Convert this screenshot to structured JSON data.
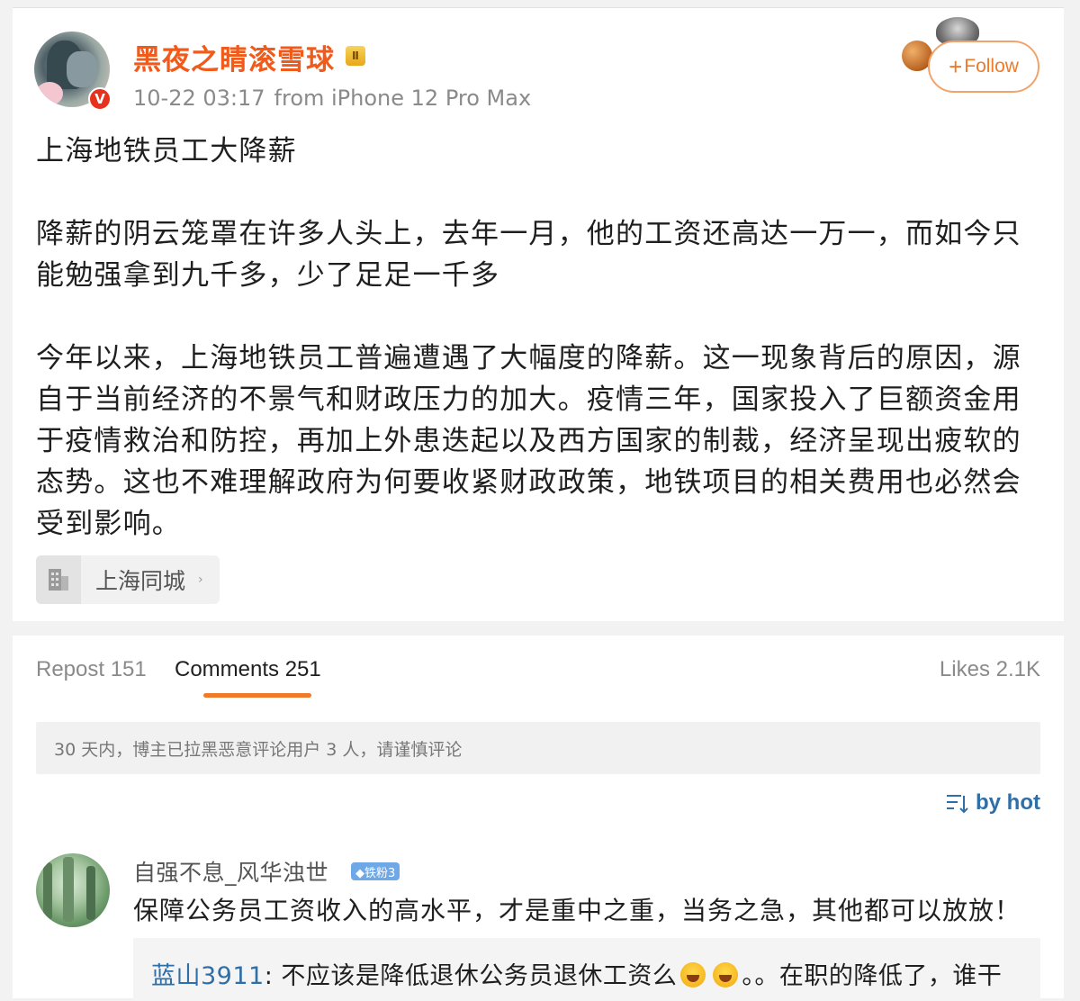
{
  "post": {
    "author": "黑夜之睛滚雪球",
    "verified_badge": "V",
    "level_badge": "Ⅱ",
    "time": "10-22 03:17",
    "source": "from iPhone 12 Pro Max",
    "follow_label": "Follow",
    "follow_plus": "+",
    "paragraphs": [
      "上海地铁员工大降薪",
      "降薪的阴云笼罩在许多人头上，去年一月，他的工资还高达一万一，而如今只能勉强拿到九千多，少了足足一千多",
      "今年以来，上海地铁员工普遍遭遇了大幅度的降薪。这一现象背后的原因，源自于当前经济的不景气和财政压力的加大。疫情三年，国家投入了巨额资金用于疫情救治和防控，再加上外患迭起以及西方国家的制裁，经济呈现出疲软的态势。这也不难理解政府为何要收紧财政政策，地铁项目的相关费用也必然会受到影响。"
    ],
    "location_tag": "上海同城",
    "location_arrow": "›"
  },
  "tabs": {
    "repost": "Repost 151",
    "comments": "Comments 251",
    "likes": "Likes 2.1K"
  },
  "notice": "30 天内，博主已拉黑恶意评论用户 3 人，请谨慎评论",
  "sort_label": "by hot",
  "comment": {
    "user": "自强不息_风华浊世",
    "fan_badge": "◆铁粉3",
    "text": "保障公务员工资收入的高水平，才是重中之重，当务之急，其他都可以放放！",
    "reply": {
      "user": "蓝山3911",
      "text_before": ": 不应该是降低退休公务员退休工资么",
      "text_after": "。。在职的降低了，谁干"
    }
  },
  "colors": {
    "accent_orange": "#f07a2a",
    "link_blue": "#2f6ea6"
  }
}
